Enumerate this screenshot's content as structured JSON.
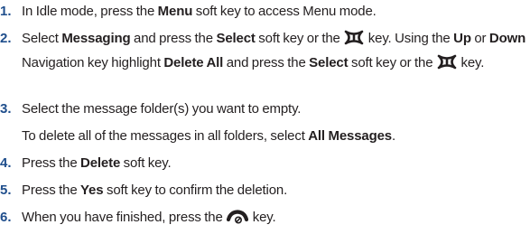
{
  "steps": [
    {
      "number": "1.",
      "t1": "In Idle mode, press the ",
      "b1": "Menu",
      "t2": " soft key to access Menu mode."
    },
    {
      "number": "2.",
      "t1": "Select ",
      "b1": "Messaging",
      "t2": " and press the ",
      "b2": "Select",
      "t3": " soft key or the ",
      "icon1": "ok-key-icon",
      "t4": " key. Using the ",
      "b3": "Up",
      "t5": " or ",
      "b4": "Down",
      "t6": " Navigation key highlight ",
      "b5": "Delete All",
      "t7": " and press the ",
      "b6": "Select",
      "t8": " soft key or the ",
      "icon2": "ok-key-icon",
      "t9": " key."
    },
    {
      "number": "3.",
      "t1": "Select the message folder(s) you want to empty.",
      "note_text": "To delete all of the messages in all folders, select ",
      "note_bold": "All Messages",
      "note_end": "."
    },
    {
      "number": "4.",
      "t1": "Press the ",
      "b1": "Delete",
      "t2": " soft key."
    },
    {
      "number": "5.",
      "t1": "Press the ",
      "b1": "Yes",
      "t2": " soft key to confirm the deletion."
    },
    {
      "number": "6.",
      "t1": "When you have finished, press the ",
      "icon1": "end-key-icon",
      "t2": " key."
    }
  ],
  "colors": {
    "number": "#1f4e8c",
    "text": "#231f20"
  }
}
